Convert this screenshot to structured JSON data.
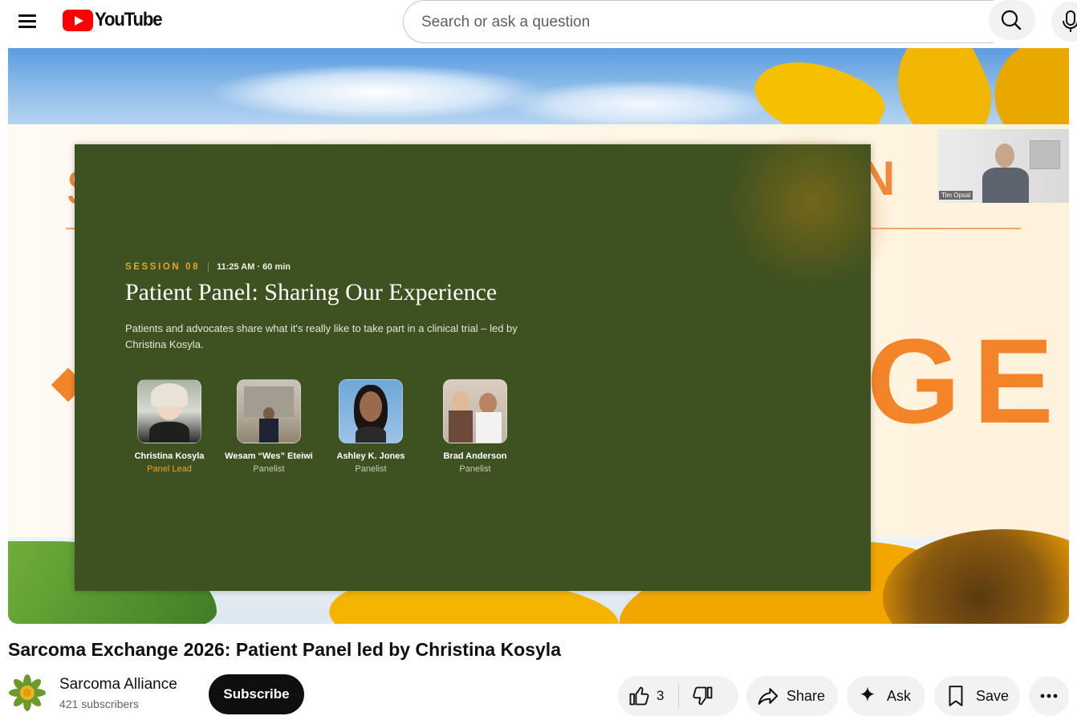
{
  "header": {
    "logo_text": "YouTube",
    "search_placeholder": "Search or ask a question"
  },
  "video": {
    "slide": {
      "session_tag": "SESSION 08",
      "session_time": "11:25 AM · 60 min",
      "title": "Patient Panel: Sharing Our Experience",
      "description": "Patients and advocates share what it's really like to take part in a clinical trial – led by Christina Kosyla.",
      "background_letters_left": "S",
      "background_letters_right": "N",
      "background_word": "GE",
      "panelists": [
        {
          "name": "Christina Kosyla",
          "role": "Panel Lead"
        },
        {
          "name": "Wesam “Wes” Eteiwi",
          "role": "Panelist"
        },
        {
          "name": "Ashley K. Jones",
          "role": "Panelist"
        },
        {
          "name": "Brad Anderson",
          "role": "Panelist"
        }
      ],
      "accent_color": "#e6a428",
      "panel_color": "#3e5120"
    },
    "speaker_name": "Tim Opsal"
  },
  "title": "Sarcoma Exchange 2026: Patient Panel led by Christina Kosyla",
  "channel": {
    "name": "Sarcoma Alliance",
    "subscribers": "421 subscribers",
    "subscribe_label": "Subscribe"
  },
  "actions": {
    "like_count": "3",
    "share_label": "Share",
    "ask_label": "Ask",
    "save_label": "Save"
  },
  "icons": [
    "menu-icon",
    "search-icon",
    "mic-icon",
    "like-icon",
    "dislike-icon",
    "share-icon",
    "sparkle-icon",
    "bookmark-icon",
    "more-icon"
  ]
}
